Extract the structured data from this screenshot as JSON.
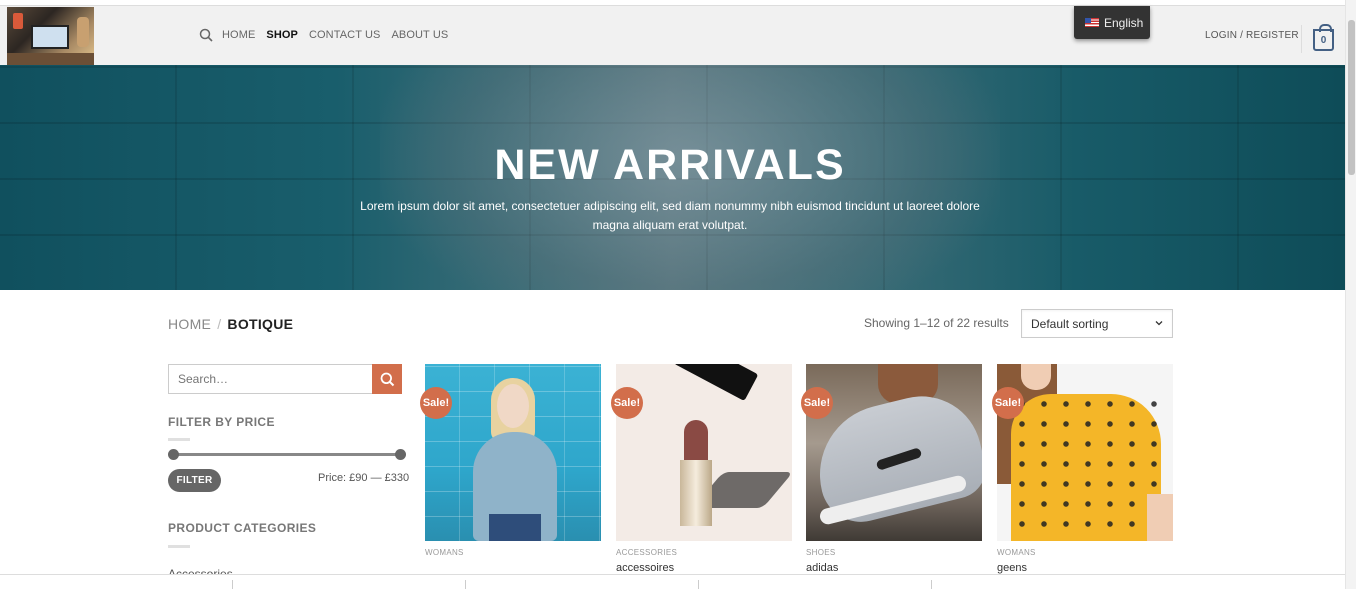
{
  "header": {
    "nav": [
      "HOME",
      "SHOP",
      "CONTACT US",
      "ABOUT US"
    ],
    "active_nav": "SHOP",
    "language": "English",
    "login_label": "LOGIN / REGISTER",
    "cart_count": "0"
  },
  "hero": {
    "title": "NEW ARRIVALS",
    "text": "Lorem ipsum dolor sit amet, consectetuer adipiscing elit, sed diam nonummy nibh euismod tincidunt ut laoreet dolore magna aliquam erat volutpat."
  },
  "breadcrumb": {
    "home": "HOME",
    "separator": "/",
    "current": "BOTIQUE"
  },
  "results": {
    "showing": "Showing 1–12 of 22 results",
    "sort_selected": "Default sorting"
  },
  "sidebar": {
    "search_placeholder": "Search…",
    "filter_title": "FILTER BY PRICE",
    "filter_button": "FILTER",
    "price_range": "Price: £90 — £330",
    "categories_title": "PRODUCT CATEGORIES",
    "first_category": "Accessories"
  },
  "products": [
    {
      "badge": "Sale!",
      "category": "WOMANS",
      "name": ""
    },
    {
      "badge": "Sale!",
      "category": "ACCESSORIES",
      "name": "accessoires"
    },
    {
      "badge": "Sale!",
      "category": "SHOES",
      "name": "adidas"
    },
    {
      "badge": "Sale!",
      "category": "WOMANS",
      "name": "geens"
    }
  ],
  "colors": {
    "accent": "#d26e4b",
    "cart": "#446084",
    "hero": "#15596a"
  }
}
